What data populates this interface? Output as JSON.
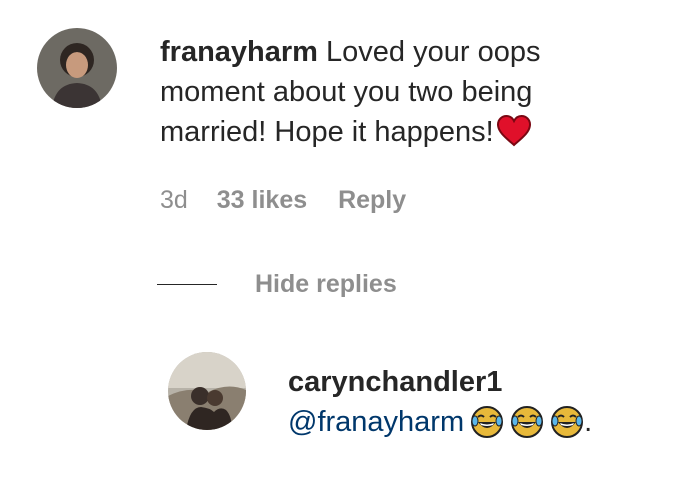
{
  "comment": {
    "username": "franayharm",
    "text": "Loved your oops moment about you two being married! Hope it happens!",
    "emoji": "red-heart",
    "time": "3d",
    "likes": "33 likes",
    "reply_label": "Reply",
    "hide_replies_label": "Hide replies"
  },
  "reply": {
    "username": "carynchandler1",
    "mention": "@franayharm",
    "emojis": [
      "face-with-tears-of-joy",
      "face-with-tears-of-joy",
      "face-with-tears-of-joy"
    ],
    "trailing": "."
  },
  "colors": {
    "text": "#262626",
    "meta": "#8e8e8e",
    "mention": "#00376b",
    "heart": "#e0102a"
  }
}
